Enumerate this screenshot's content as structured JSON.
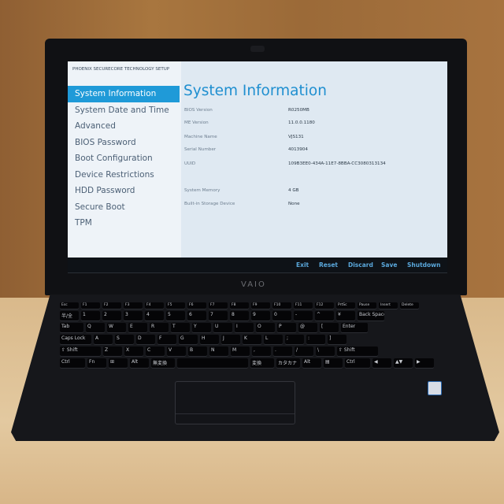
{
  "bios": {
    "brand": "PHOENIX SECURECORE TECHNOLOGY SETUP",
    "nav": [
      "System Information",
      "System Date and Time",
      "Advanced",
      "BIOS Password",
      "Boot Configuration",
      "Device Restrictions",
      "HDD Password",
      "Secure Boot",
      "TPM"
    ],
    "selected_index": 0,
    "title": "System Information",
    "rows": [
      {
        "label": "BIOS Version",
        "value": "R0250MB"
      },
      {
        "label": "ME Version",
        "value": "11.0.0.1180"
      },
      {
        "label": "Machine Name",
        "value": "VJS131"
      },
      {
        "label": "Serial Number",
        "value": "4013904"
      },
      {
        "label": "UUID",
        "value": "109B3EE0-434A-11E7-8BBA-CC3080313134"
      },
      {
        "label": "System Memory",
        "value": "4 GB"
      },
      {
        "label": "Built-in Storage Device",
        "value": "None"
      }
    ],
    "actions": [
      "Exit",
      "Reset",
      "Discard",
      "Save",
      "Shutdown"
    ],
    "accent": "#1f9ad8"
  },
  "logo": "VAIO",
  "keyboard": [
    [
      "Esc",
      "F1",
      "F2",
      "F3",
      "F4",
      "F5",
      "F6",
      "F7",
      "F8",
      "F9",
      "F10",
      "F11",
      "F12",
      "PrtSc",
      "Pause",
      "Insert",
      "Delete"
    ],
    [
      "半/全",
      "1",
      "2",
      "3",
      "4",
      "5",
      "6",
      "7",
      "8",
      "9",
      "0",
      "-",
      "^",
      "¥",
      "Back Space"
    ],
    [
      "Tab",
      "Q",
      "W",
      "E",
      "R",
      "T",
      "Y",
      "U",
      "I",
      "O",
      "P",
      "@",
      "[",
      "Enter"
    ],
    [
      "Caps Lock",
      "A",
      "S",
      "D",
      "F",
      "G",
      "H",
      "J",
      "K",
      "L",
      ";",
      ":",
      "]"
    ],
    [
      "⇧ Shift",
      "Z",
      "X",
      "C",
      "V",
      "B",
      "N",
      "M",
      ",",
      ".",
      "/",
      "\\",
      "⇧ Shift"
    ],
    [
      "Ctrl",
      "Fn",
      "⊞",
      "Alt",
      "無変換",
      "",
      "変換",
      "カタカナ",
      "Alt",
      "▤",
      "Ctrl",
      "◀",
      "▲▼",
      "▶"
    ]
  ]
}
